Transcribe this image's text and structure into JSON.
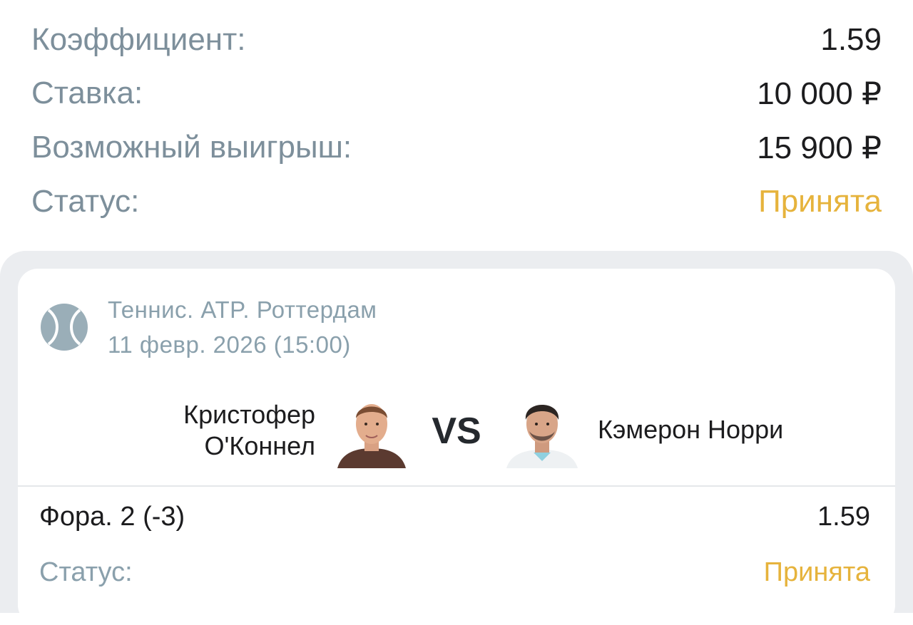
{
  "summary": {
    "coefficient_label": "Коэффициент:",
    "coefficient_value": "1.59",
    "stake_label": "Ставка:",
    "stake_value": "10 000 ₽",
    "win_label": "Возможный выигрыш:",
    "win_value": "15 900 ₽",
    "status_label": "Статус:",
    "status_value": "Принята"
  },
  "event": {
    "league": "Теннис. ATP. Роттердам",
    "date": "11 февр. 2026 (15:00)",
    "sport_icon": "tennis-ball-icon",
    "player1_line1": "Кристофер",
    "player1_line2": "О'Коннел",
    "vs": "VS",
    "player2": "Кэмерон Норри"
  },
  "bet": {
    "market": "Фора. 2 (-3)",
    "odds": "1.59",
    "status_label": "Статус:",
    "status_value": "Принята"
  },
  "colors": {
    "label": "#7d8f9b",
    "value": "#1c1c1e",
    "status": "#e6b33c",
    "muted": "#8aa0ac",
    "background_gray": "#ebedf0"
  }
}
